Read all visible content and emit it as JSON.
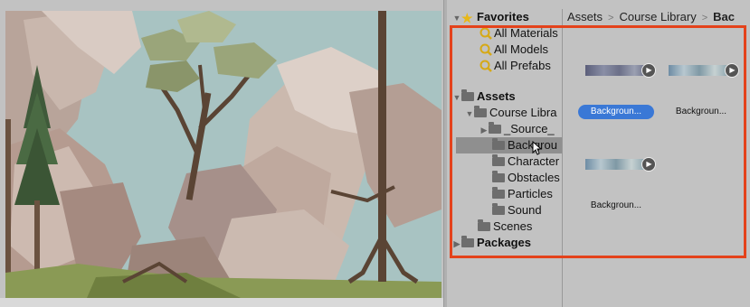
{
  "tree": {
    "favorites": {
      "label": "Favorites",
      "items": [
        "All Materials",
        "All Models",
        "All Prefabs"
      ]
    },
    "assets": {
      "label": "Assets",
      "course_library": "Course Libra",
      "children": [
        {
          "label": "_Source_",
          "expandable": true
        },
        {
          "label": "Backgrou",
          "selected": true
        },
        {
          "label": "Character"
        },
        {
          "label": "Obstacles"
        },
        {
          "label": "Particles"
        },
        {
          "label": "Sound"
        }
      ],
      "scenes": "Scenes"
    },
    "packages": "Packages"
  },
  "breadcrumb": [
    "Assets",
    "Course Library",
    "Bac"
  ],
  "assets_grid": [
    {
      "label": "Backgroun...",
      "selected": true,
      "style": "mountain"
    },
    {
      "label": "Backgroun...",
      "selected": false,
      "style": "sky"
    },
    {
      "label": "Backgroun...",
      "selected": false,
      "style": "sky"
    }
  ],
  "colors": {
    "highlight": "#e4421b",
    "selection_blue": "#3a78d6",
    "star": "#e8b817"
  }
}
